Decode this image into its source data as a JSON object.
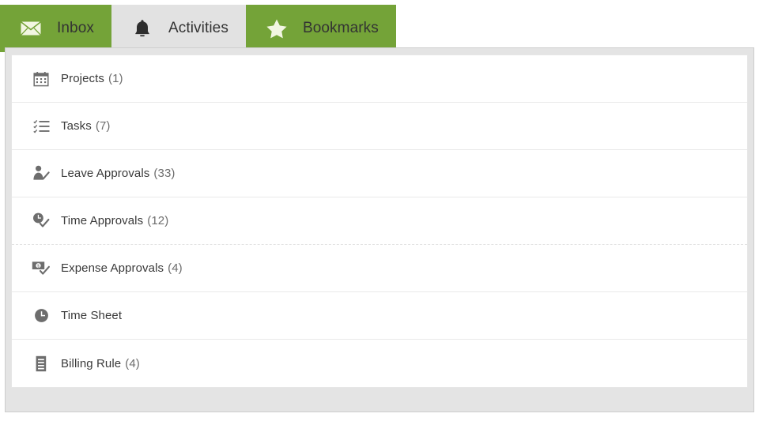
{
  "colors": {
    "tab_green": "#74a338",
    "tab_active_bg": "#e2e2e2",
    "panel_bg": "#e4e4e4",
    "row_bg": "#ffffff",
    "icon_gray": "#6d6d6d",
    "text": "#3a3a3a"
  },
  "tabs": [
    {
      "id": "inbox",
      "label": "Inbox",
      "icon": "envelope-icon",
      "state": "inactive"
    },
    {
      "id": "activities",
      "label": "Activities",
      "icon": "bell-icon",
      "state": "active"
    },
    {
      "id": "bookmarks",
      "label": "Bookmarks",
      "icon": "star-icon",
      "state": "inactive"
    }
  ],
  "activities_list": [
    {
      "id": "projects",
      "label": "Projects",
      "count": "(1)",
      "icon": "calendar-icon"
    },
    {
      "id": "tasks",
      "label": "Tasks",
      "count": "(7)",
      "icon": "ordered-list-icon"
    },
    {
      "id": "leave-approvals",
      "label": "Leave Approvals",
      "count": "(33)",
      "icon": "person-check-icon"
    },
    {
      "id": "time-approvals",
      "label": "Time Approvals",
      "count": "(12)",
      "icon": "clock-check-icon"
    },
    {
      "id": "expense-approvals",
      "label": "Expense Approvals",
      "count": "(4)",
      "icon": "money-check-icon"
    },
    {
      "id": "time-sheet",
      "label": "Time Sheet",
      "count": "",
      "icon": "clock-icon"
    },
    {
      "id": "billing-rule",
      "label": "Billing Rule",
      "count": "(4)",
      "icon": "document-lines-icon"
    }
  ]
}
